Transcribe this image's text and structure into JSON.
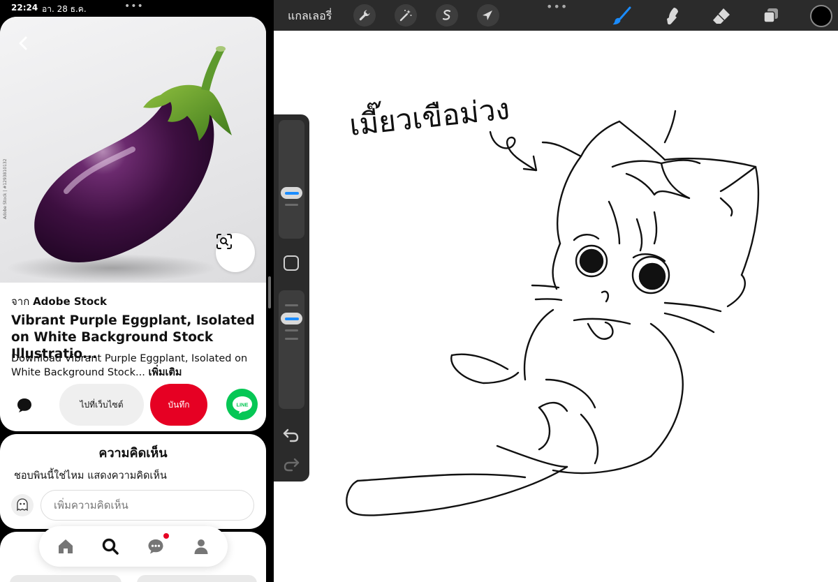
{
  "status_bar": {
    "time": "22:24",
    "date": "อา. 28 ธ.ค.",
    "dots": "•••"
  },
  "pin": {
    "image_watermark": "Adobe Stock | #1293810132",
    "source_prefix": "จาก",
    "source_name": "Adobe Stock",
    "title": "Vibrant Purple Eggplant, Isolated on White Background Stock Illustratio...",
    "description": "Download Vibrant Purple Eggplant, Isolated on White Background Stock...",
    "more_link": "เพิ่มเติม",
    "visit_label": "ไปที่เว็บไซต์",
    "save_label": "บันทึก",
    "line_label": "LINE"
  },
  "comments": {
    "title": "ความคิดเห็น",
    "prompt": "ชอบพินนี้ใช่ไหม แสดงความคิดเห็น",
    "input_placeholder": "เพิ่มความคิดเห็น"
  },
  "bottom_nav": {
    "items": [
      "home-icon",
      "search-icon",
      "messages-icon",
      "profile-icon"
    ],
    "notification_color": "#e60023"
  },
  "procreate": {
    "gallery_label": "แกลเลอรี่",
    "top_dots": "•••",
    "left_tools": [
      "wrench-icon",
      "magic-wand-icon",
      "selection-icon",
      "transform-arrow-icon"
    ],
    "right_tools": [
      "brush-icon",
      "smudge-icon",
      "eraser-icon",
      "layers-icon"
    ],
    "active_tool_color": "#1a8cff",
    "current_color": "#000000",
    "sketch_caption": "เมี๊ยวเขือม่วง"
  },
  "colors": {
    "pinterest_red": "#e60023",
    "line_green": "#06c755",
    "procreate_bar": "#2b2b2b"
  }
}
